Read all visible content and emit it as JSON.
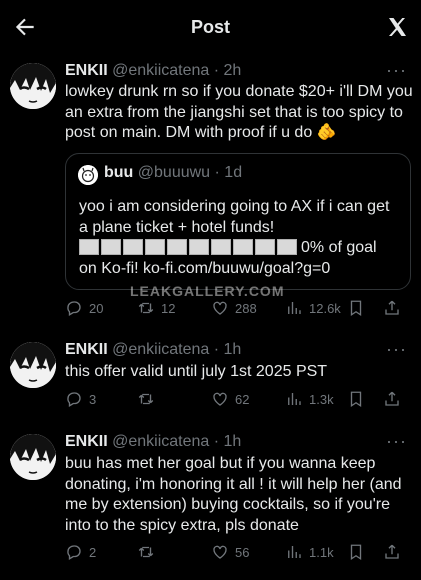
{
  "header": {
    "title": "Post"
  },
  "watermark": "LEAKGALLERY.COM",
  "tweets": [
    {
      "name": "ENKII",
      "handle": "@enkiicatena",
      "time": "2h",
      "text": "lowkey drunk rn so if you donate $20+ i'll DM you an extra from the jiangshi set that is too spicy to post on main.  DM with proof if u do 🫵",
      "quote": {
        "name": "buu",
        "handle": "@buuuwu",
        "time": "1d",
        "text_line1": "yoo i am considering going to AX if i can get a plane ticket + hotel funds!",
        "progress_percent": 0,
        "progress_text": "0% of goal",
        "text_line3": "on Ko-fi! ko-fi.com/buuwu/goal?g=0"
      },
      "stats": {
        "replies": "20",
        "reposts": "12",
        "likes": "288",
        "views": "12.6k"
      }
    },
    {
      "name": "ENKII",
      "handle": "@enkiicatena",
      "time": "1h",
      "text": "this offer valid until  july 1st 2025 PST",
      "stats": {
        "replies": "3",
        "reposts": "",
        "likes": "62",
        "views": "1.3k"
      }
    },
    {
      "name": "ENKII",
      "handle": "@enkiicatena",
      "time": "1h",
      "text": "buu has met her goal but if you wanna keep donating, i'm honoring it all ! it will help her (and me by extension) buying cocktails, so if you're into to the spicy extra, pls donate",
      "stats": {
        "replies": "2",
        "reposts": "",
        "likes": "56",
        "views": "1.1k"
      }
    }
  ]
}
